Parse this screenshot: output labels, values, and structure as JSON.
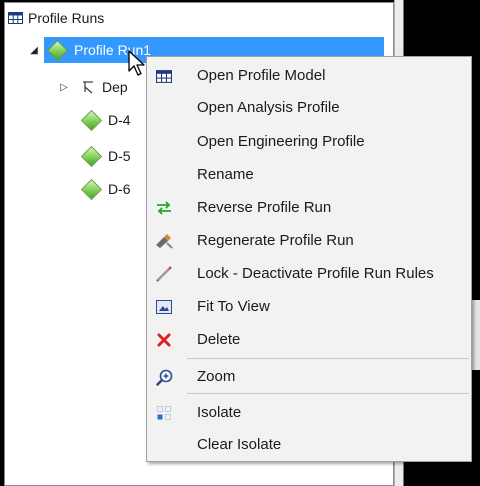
{
  "tree": {
    "root_label": "Profile Runs",
    "run_label": "Profile Run1",
    "children": [
      {
        "label": "Dep",
        "icon": "dependency-icon"
      },
      {
        "label": "D-4",
        "icon": "diamond-icon"
      },
      {
        "label": "D-5",
        "icon": "diamond-icon"
      },
      {
        "label": "D-6",
        "icon": "diamond-icon"
      }
    ],
    "selection_color": "#3399ff"
  },
  "context_menu": {
    "items": [
      {
        "label": "Open Profile Model",
        "icon": "grid-icon"
      },
      {
        "label": "Open Analysis Profile",
        "icon": ""
      },
      {
        "label": "Open Engineering Profile",
        "icon": ""
      },
      {
        "label": "Rename",
        "icon": ""
      },
      {
        "label": "Reverse Profile Run",
        "icon": "reverse-arrows-icon"
      },
      {
        "label": "Regenerate Profile Run",
        "icon": "regenerate-icon"
      },
      {
        "label": "Lock - Deactivate Profile Run Rules",
        "icon": "lock-pencil-icon"
      },
      {
        "label": "Fit To View",
        "icon": "fit-to-view-icon"
      },
      {
        "label": "Delete",
        "icon": "delete-x-icon"
      },
      {
        "label": "Zoom",
        "icon": "zoom-icon"
      },
      {
        "label": "Isolate",
        "icon": "isolate-icon"
      },
      {
        "label": "Clear Isolate",
        "icon": ""
      }
    ]
  }
}
